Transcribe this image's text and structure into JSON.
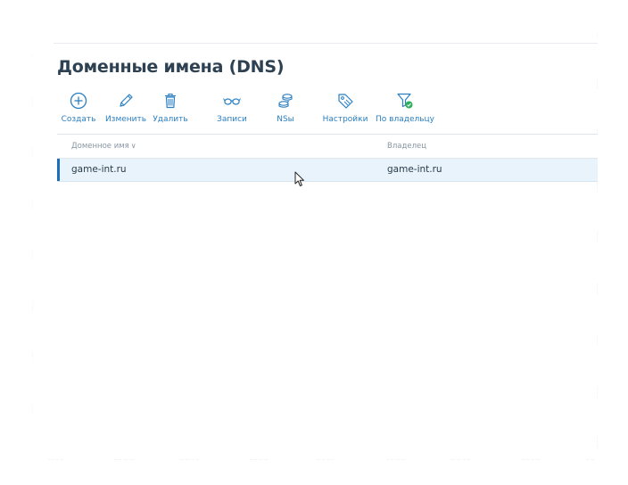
{
  "page": {
    "title": "Доменные имена (DNS)"
  },
  "toolbar": {
    "items": [
      {
        "label": "Создать",
        "icon": "plus-circle-icon"
      },
      {
        "label": "Изменить",
        "icon": "pencil-icon"
      },
      {
        "label": "Удалить",
        "icon": "trash-icon"
      },
      {
        "label": "Записи",
        "icon": "glasses-icon"
      },
      {
        "label": "NSы",
        "icon": "servers-icon"
      },
      {
        "label": "Настройки",
        "icon": "tag-icon"
      },
      {
        "label": "По владельцу",
        "icon": "filter-icon"
      }
    ]
  },
  "table": {
    "columns": [
      {
        "label": "Доменное имя",
        "sort_icon": "chevron-down-icon"
      },
      {
        "label": "Владелец"
      }
    ],
    "rows": [
      {
        "domain": "game-int.ru",
        "owner": "game-int.ru",
        "selected": true
      }
    ]
  },
  "colors": {
    "title": "#2e4152",
    "accent": "#2b7fc1",
    "selected_row": "#e8f3fb",
    "selected_marker": "#1e6fb8",
    "filter_badge": "#2fae5a"
  }
}
